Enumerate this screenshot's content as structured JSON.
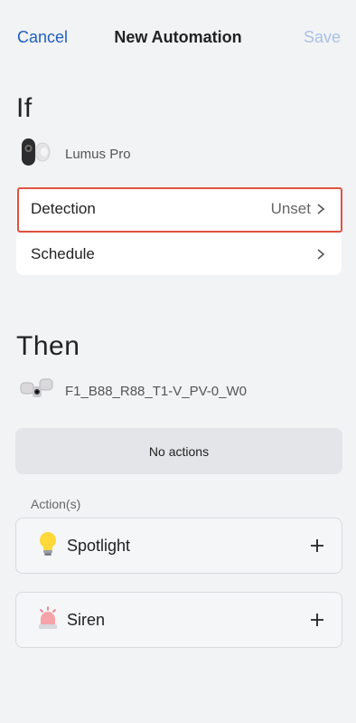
{
  "header": {
    "cancel_label": "Cancel",
    "title": "New Automation",
    "save_label": "Save"
  },
  "if_section": {
    "heading": "If",
    "device_name": "Lumus Pro",
    "device_icon": "camera-device-icon",
    "rows": [
      {
        "label": "Detection",
        "value": "Unset",
        "highlighted": true
      },
      {
        "label": "Schedule",
        "value": ""
      }
    ]
  },
  "then_section": {
    "heading": "Then",
    "device_name": "F1_B88_R88_T1-V_PV-0_W0",
    "device_icon": "floodlight-camera-icon",
    "no_actions_label": "No actions",
    "actions_label": "Action(s)",
    "actions": [
      {
        "label": "Spotlight",
        "icon": "lightbulb-icon"
      },
      {
        "label": "Siren",
        "icon": "siren-icon"
      }
    ]
  },
  "colors": {
    "accent": "#1f5fbf",
    "save_disabled": "#a9c2e6",
    "highlight": "#e05141",
    "background": "#f2f3f5"
  }
}
